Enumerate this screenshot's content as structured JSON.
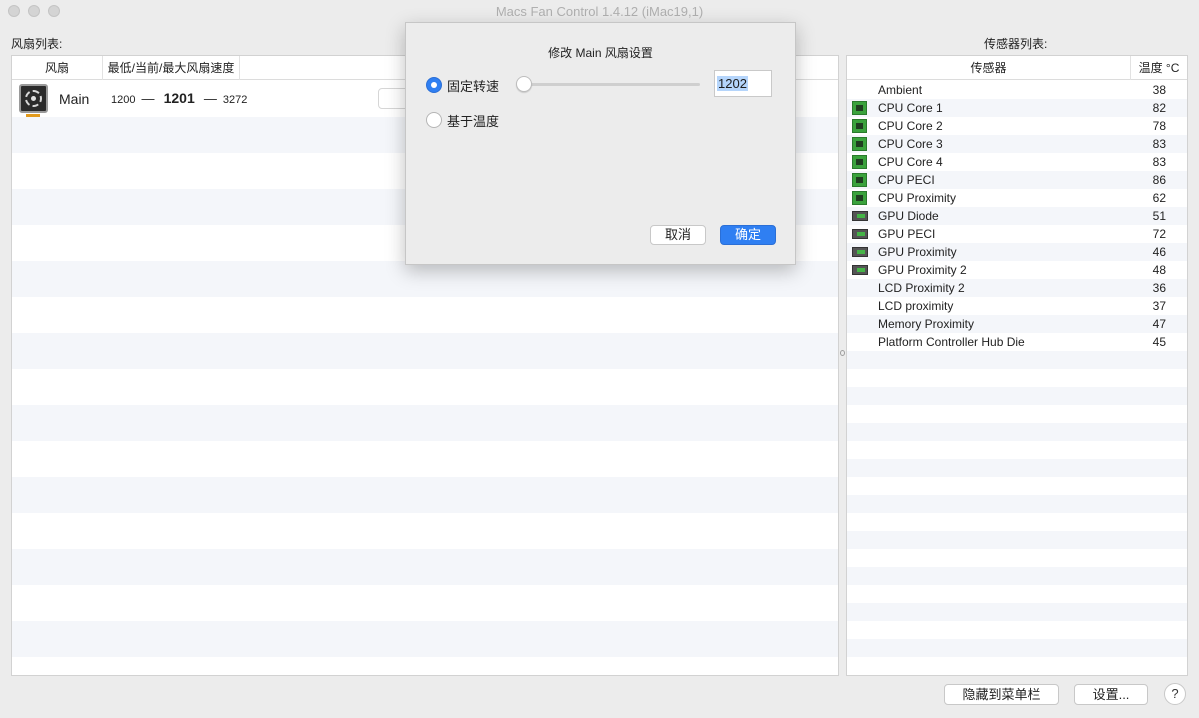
{
  "window": {
    "title": "Macs Fan Control 1.4.12 (iMac19,1)"
  },
  "fan_section": {
    "label": "风扇列表:",
    "columns": [
      "风扇",
      "最低/当前/最大风扇速度"
    ],
    "fans": [
      {
        "name": "Main",
        "min": "1200",
        "current": "1201",
        "max": "3272",
        "separator": "—"
      }
    ]
  },
  "sensor_section": {
    "label": "传感器列表:",
    "columns": [
      "传感器",
      "温度 °C"
    ],
    "sensors": [
      {
        "name": "Ambient",
        "value": "38",
        "icon": "none"
      },
      {
        "name": "CPU Core 1",
        "value": "82",
        "icon": "cpu-chip-icon"
      },
      {
        "name": "CPU Core 2",
        "value": "78",
        "icon": "cpu-chip-icon"
      },
      {
        "name": "CPU Core 3",
        "value": "83",
        "icon": "cpu-chip-icon"
      },
      {
        "name": "CPU Core 4",
        "value": "83",
        "icon": "cpu-chip-icon"
      },
      {
        "name": "CPU PECI",
        "value": "86",
        "icon": "cpu-chip-icon"
      },
      {
        "name": "CPU Proximity",
        "value": "62",
        "icon": "cpu-chip-icon"
      },
      {
        "name": "GPU Diode",
        "value": "51",
        "icon": "gpu-card-icon"
      },
      {
        "name": "GPU PECI",
        "value": "72",
        "icon": "gpu-card-icon"
      },
      {
        "name": "GPU Proximity",
        "value": "46",
        "icon": "gpu-card-icon"
      },
      {
        "name": "GPU Proximity 2",
        "value": "48",
        "icon": "gpu-card-icon"
      },
      {
        "name": "LCD Proximity 2",
        "value": "36",
        "icon": "none"
      },
      {
        "name": "LCD proximity",
        "value": "37",
        "icon": "none"
      },
      {
        "name": "Memory Proximity",
        "value": "47",
        "icon": "none"
      },
      {
        "name": "Platform Controller Hub Die",
        "value": "45",
        "icon": "none"
      }
    ]
  },
  "dialog": {
    "title": "修改 Main 风扇设置",
    "option_fixed": "固定转速",
    "option_temp": "基于温度",
    "selected_option": "固定转速",
    "speed_value": "1202",
    "slider_fraction": 0.0,
    "cancel_label": "取消",
    "ok_label": "确定",
    "accent_color": "#2f7ff2"
  },
  "bottom": {
    "hide_label": "隐藏到菜单栏",
    "settings_label": "设置...",
    "help_label": "?"
  }
}
